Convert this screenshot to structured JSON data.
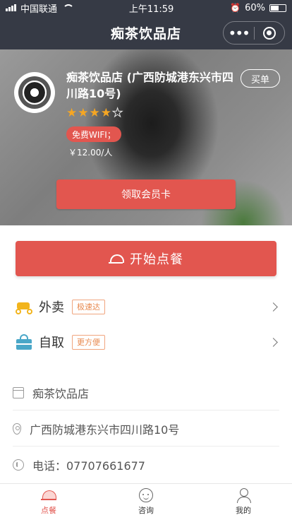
{
  "status_bar": {
    "carrier": "中国联通",
    "time": "上午11:59",
    "battery_percent": "60%",
    "battery_level": 0.6
  },
  "navbar": {
    "title": "痴茶饮品店",
    "menu_icon": "more-dots-icon",
    "close_icon": "target-circle-icon"
  },
  "store": {
    "name": "痴茶饮品店 (广西防城港东兴市四川路10号)",
    "buy_label": "买单",
    "rating": 4,
    "rating_max": 5,
    "tag": "免费WIFI；",
    "price": "￥12.00/人",
    "member_card_label": "领取会员卡"
  },
  "order": {
    "start_label": "开始点餐"
  },
  "options": [
    {
      "label": "外卖",
      "tag": "极速达",
      "icon": "scooter-icon"
    },
    {
      "label": "自取",
      "tag": "更方便",
      "icon": "bag-icon"
    }
  ],
  "info": {
    "shop_name": "痴茶饮品店",
    "address": "广西防城港东兴市四川路10号",
    "phone": "电话：07707661677"
  },
  "tabbar": {
    "items": [
      {
        "label": "点餐",
        "icon": "cloche-icon",
        "active": true
      },
      {
        "label": "咨询",
        "icon": "face-icon",
        "active": false
      },
      {
        "label": "我的",
        "icon": "user-icon",
        "active": false
      }
    ]
  },
  "colors": {
    "accent": "#e2564f",
    "navbar": "#363a45",
    "star": "#f5a623",
    "tag_border": "#f0a57e"
  }
}
